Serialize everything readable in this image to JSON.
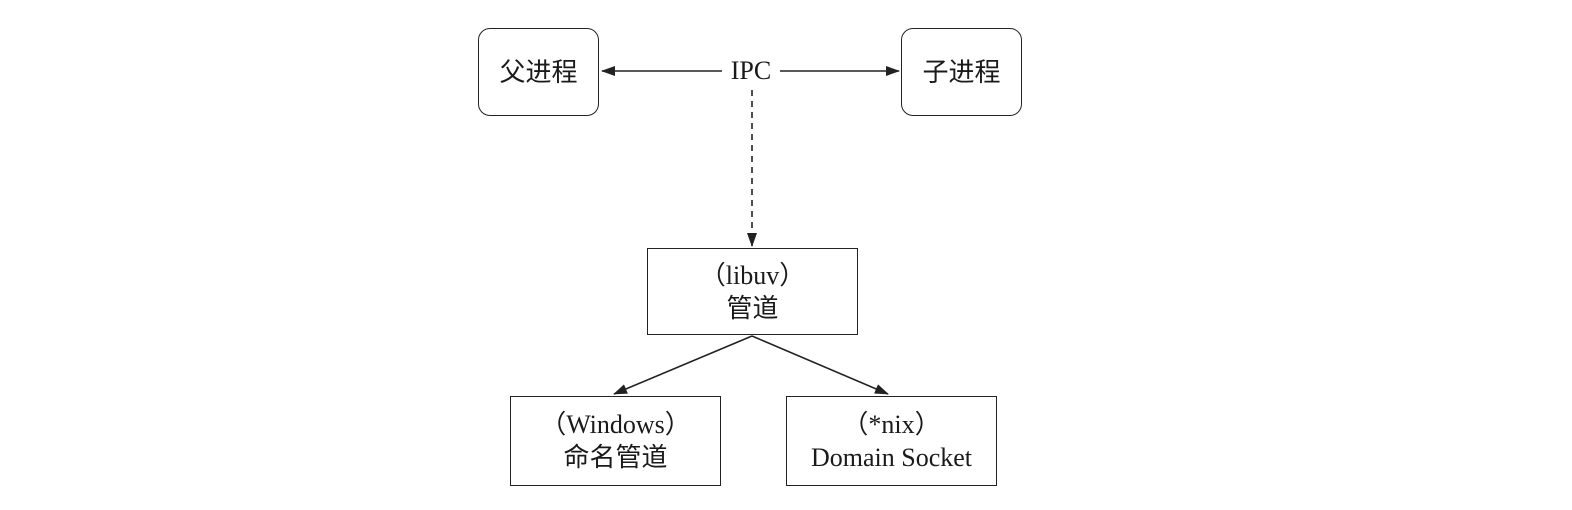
{
  "diagram": {
    "parent_process": "父进程",
    "child_process": "子进程",
    "ipc": "IPC",
    "pipe": {
      "line1": "（libuv）",
      "line2": "管道"
    },
    "windows": {
      "line1": "（Windows）",
      "line2": "命名管道"
    },
    "nix": {
      "line1": "（*nix）",
      "line2": "Domain Socket"
    }
  }
}
